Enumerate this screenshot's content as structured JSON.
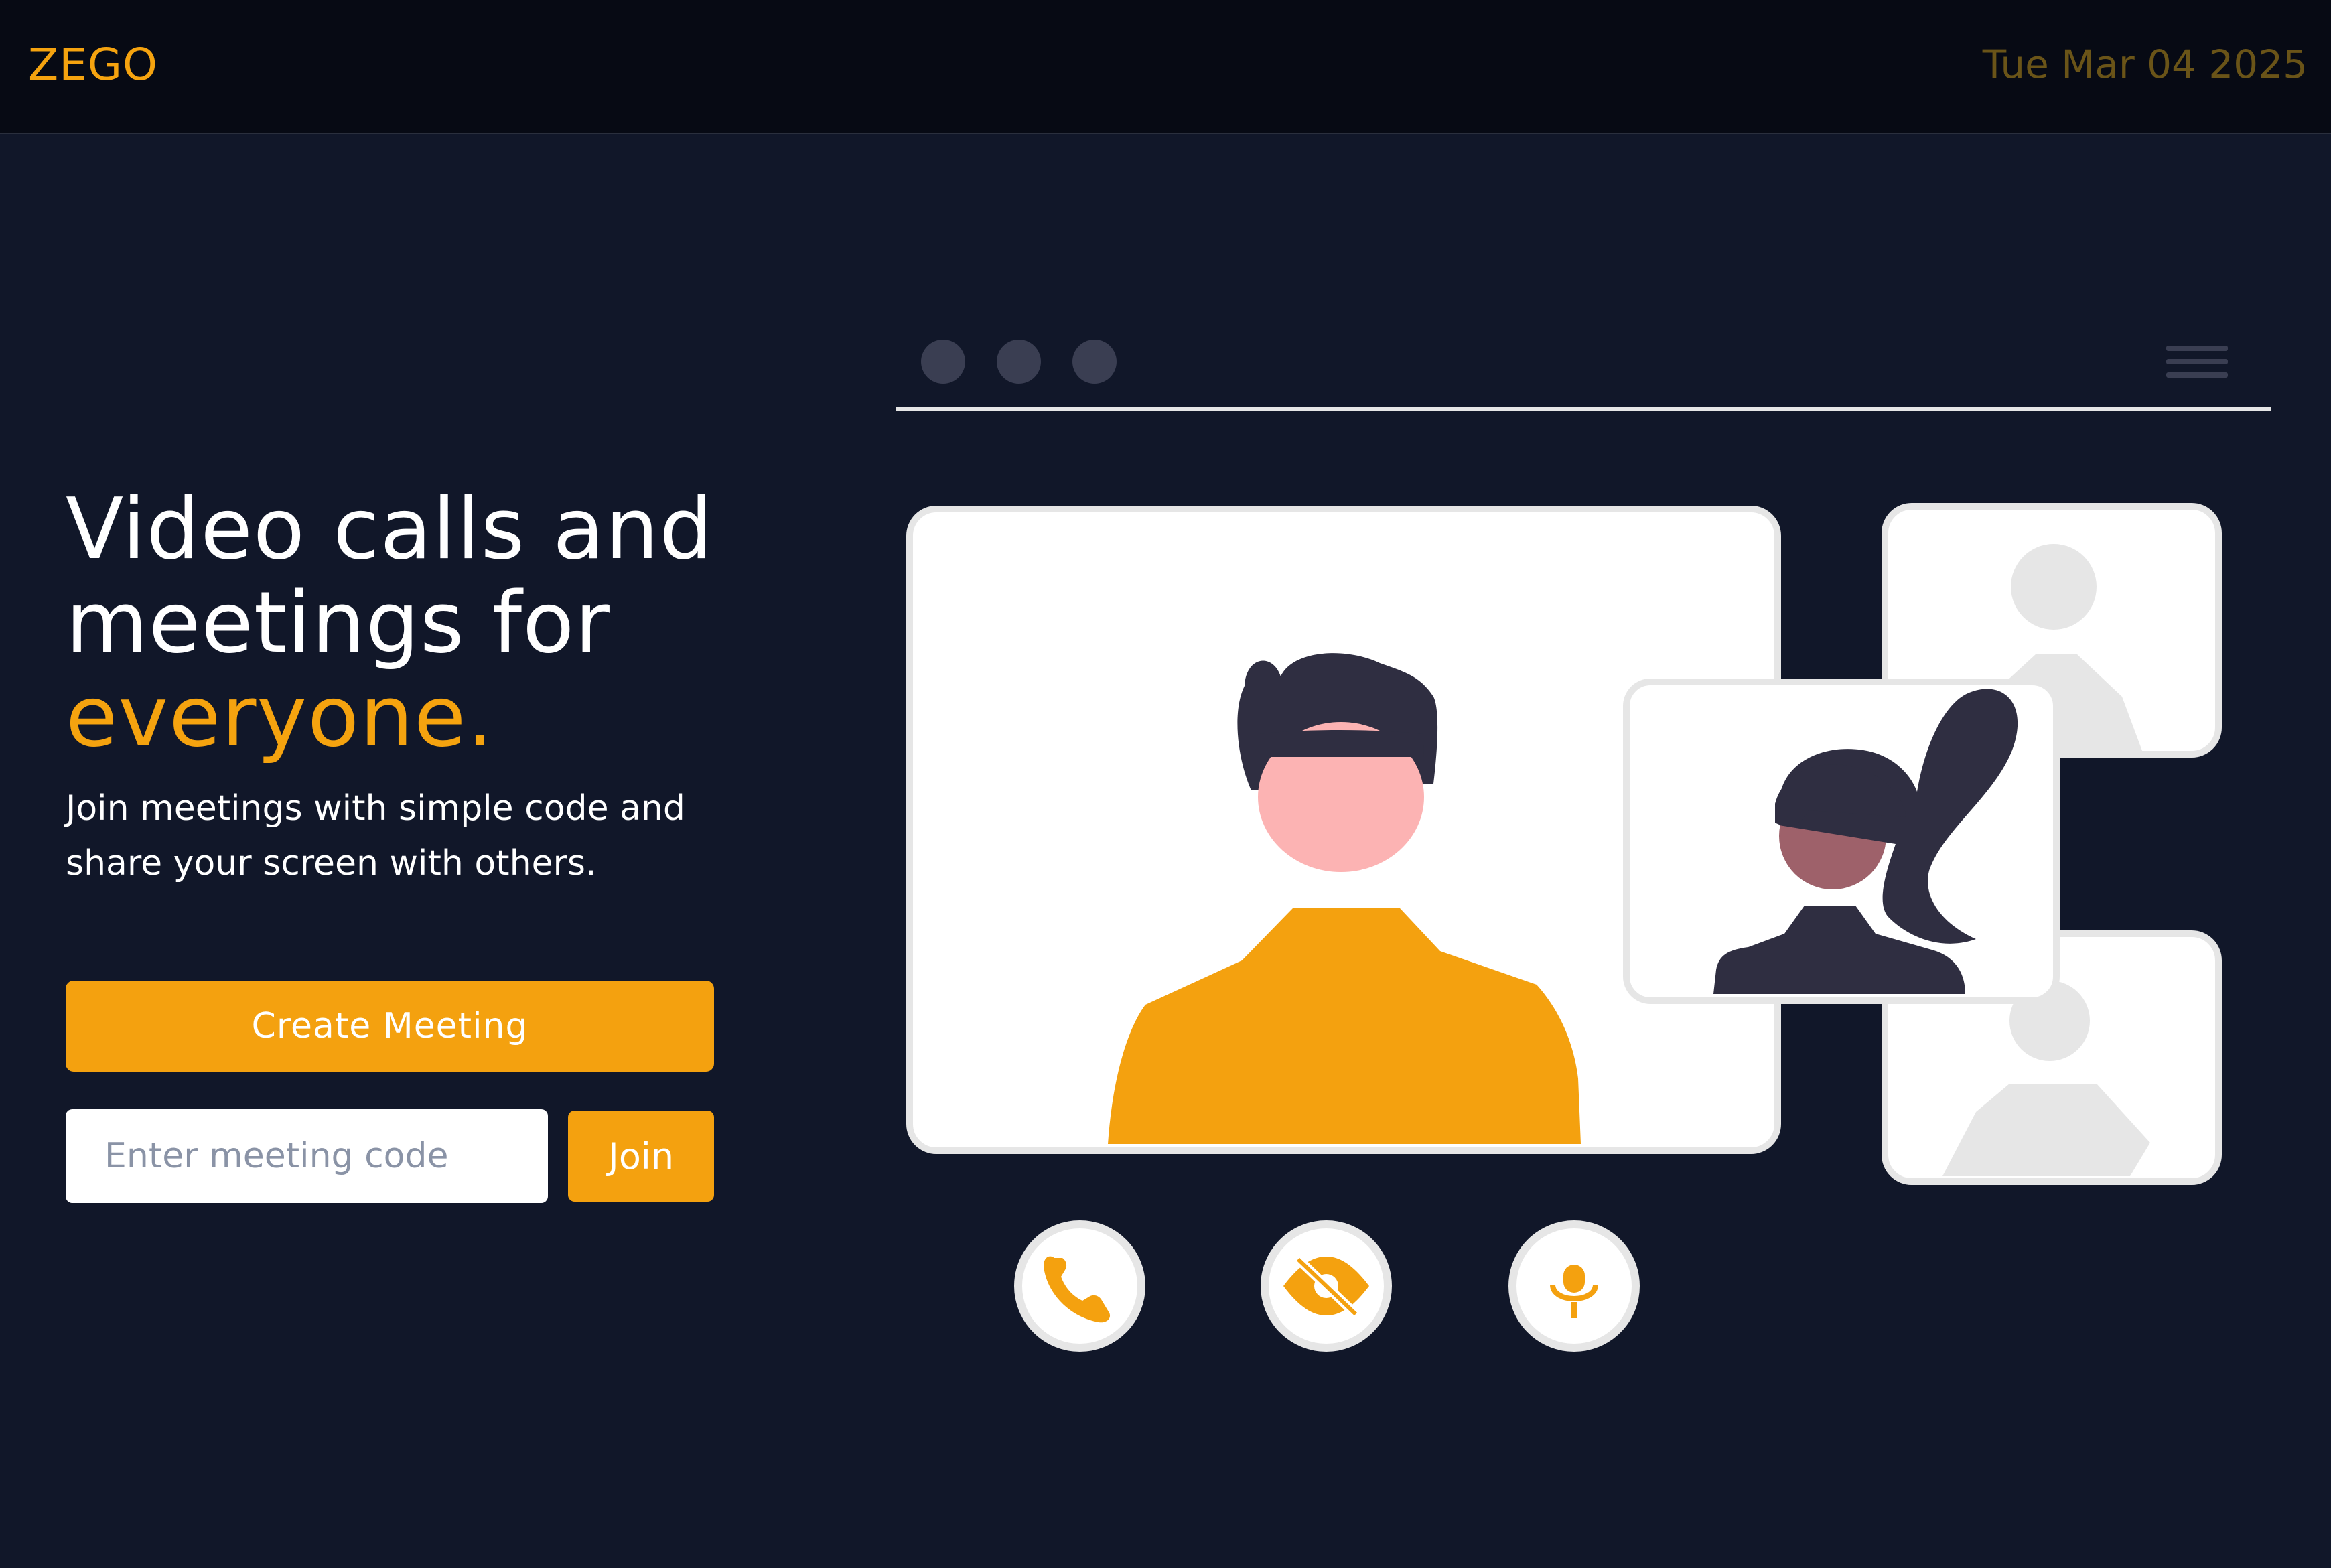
{
  "header": {
    "logo": "ZEGO",
    "date": "Tue Mar 04 2025"
  },
  "hero": {
    "title_line1": "Video calls and",
    "title_line2": "meetings for",
    "title_accent": "everyone.",
    "subtitle": "Join meetings with simple code and share your screen with others."
  },
  "actions": {
    "create_label": "Create Meeting",
    "code_placeholder": "Enter meeting code",
    "join_label": "Join"
  },
  "illustration": {
    "window_dots": [
      "dot",
      "dot",
      "dot"
    ],
    "menu_icon": "hamburger-menu-icon",
    "controls": [
      "phone-icon",
      "eye-off-icon",
      "microphone-icon"
    ]
  },
  "colors": {
    "accent": "#f5a30f",
    "background": "#111729",
    "topbar": "#070a14",
    "skin_light": "#fcb3b3",
    "skin_dark": "#9e616a",
    "hair": "#2f2e41"
  }
}
